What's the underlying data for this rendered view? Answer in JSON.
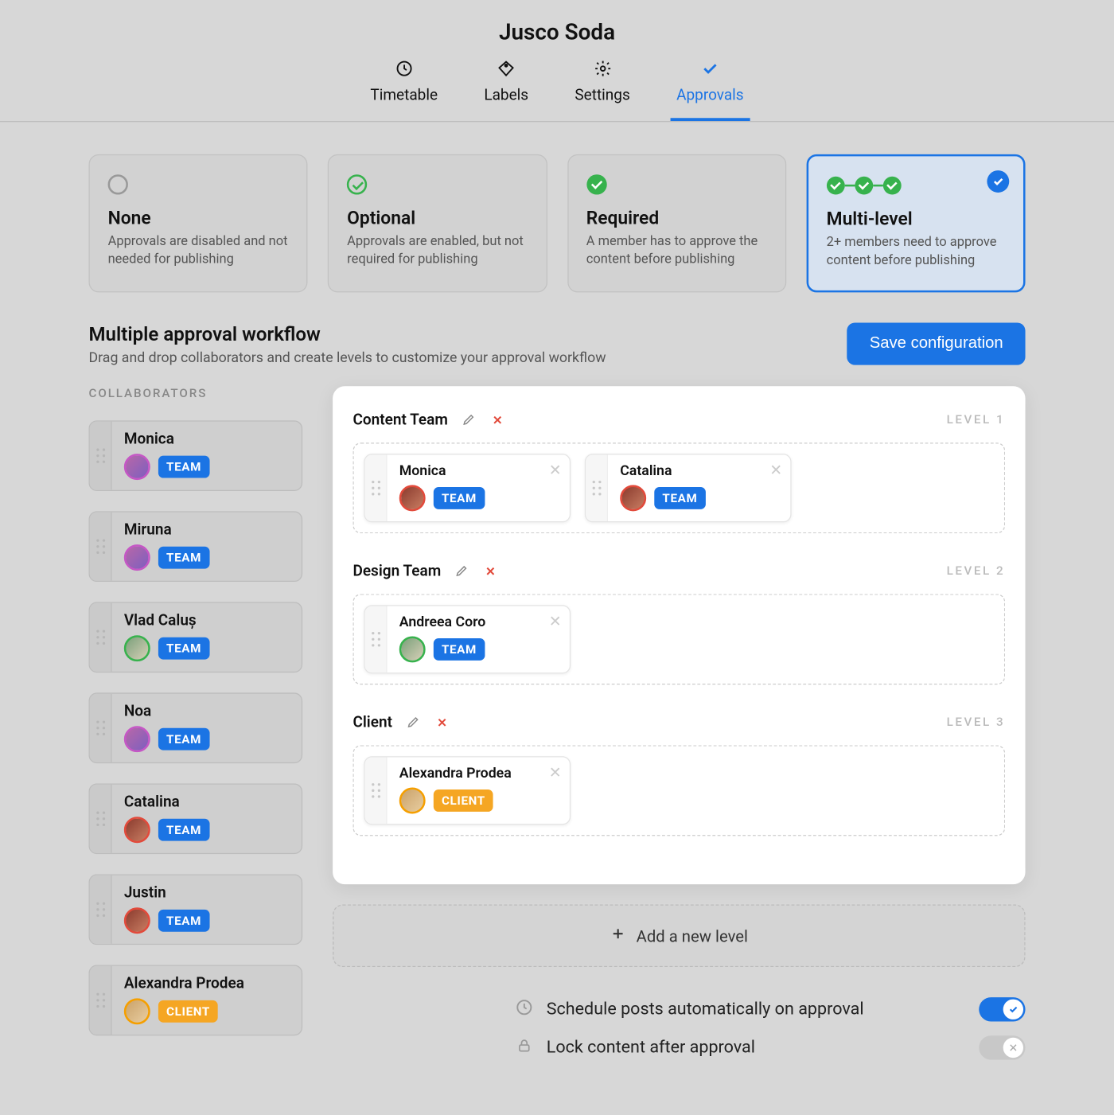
{
  "header": {
    "title": "Jusco Soda",
    "tabs": [
      {
        "label": "Timetable",
        "icon": "clock-icon",
        "active": false
      },
      {
        "label": "Labels",
        "icon": "tag-icon",
        "active": false
      },
      {
        "label": "Settings",
        "icon": "gear-icon",
        "active": false
      },
      {
        "label": "Approvals",
        "icon": "check-icon",
        "active": true
      }
    ]
  },
  "approval_options": [
    {
      "key": "none",
      "title": "None",
      "desc": "Approvals are disabled and not needed for publishing",
      "selected": false
    },
    {
      "key": "optional",
      "title": "Optional",
      "desc": "Approvals are enabled, but not required for publishing",
      "selected": false
    },
    {
      "key": "required",
      "title": "Required",
      "desc": "A member has to approve the content before publishing",
      "selected": false
    },
    {
      "key": "multi",
      "title": "Multi-level",
      "desc": "2+ members need to approve content before publishing",
      "selected": true
    }
  ],
  "section": {
    "title": "Multiple approval workflow",
    "subtitle": "Drag and drop collaborators and create levels to customize your approval workflow",
    "save_label": "Save configuration",
    "add_level_label": "Add a new level",
    "collaborators_heading": "COLLABORATORS"
  },
  "badges": {
    "team": "TEAM",
    "client": "CLIENT"
  },
  "collaborators": [
    {
      "name": "Monica",
      "badge": "team",
      "ring": "purple"
    },
    {
      "name": "Miruna",
      "badge": "team",
      "ring": "purple"
    },
    {
      "name": "Vlad Caluș",
      "badge": "team",
      "ring": "green"
    },
    {
      "name": "Noa",
      "badge": "team",
      "ring": "purple"
    },
    {
      "name": "Catalina",
      "badge": "team",
      "ring": "red"
    },
    {
      "name": "Justin",
      "badge": "team",
      "ring": "red"
    },
    {
      "name": "Alexandra Prodea",
      "badge": "client",
      "ring": "orange"
    }
  ],
  "levels": [
    {
      "name": "Content Team",
      "label": "LEVEL 1",
      "members": [
        {
          "name": "Monica",
          "badge": "team",
          "ring": "red"
        },
        {
          "name": "Catalina",
          "badge": "team",
          "ring": "red"
        }
      ]
    },
    {
      "name": "Design Team",
      "label": "LEVEL 2",
      "members": [
        {
          "name": "Andreea Coro",
          "badge": "team",
          "ring": "green"
        }
      ]
    },
    {
      "name": "Client",
      "label": "LEVEL 3",
      "members": [
        {
          "name": "Alexandra Prodea",
          "badge": "client",
          "ring": "orange"
        }
      ]
    }
  ],
  "settings": {
    "auto_schedule": {
      "label": "Schedule posts automatically on approval",
      "enabled": true
    },
    "lock_content": {
      "label": "Lock content after approval",
      "enabled": false
    }
  }
}
